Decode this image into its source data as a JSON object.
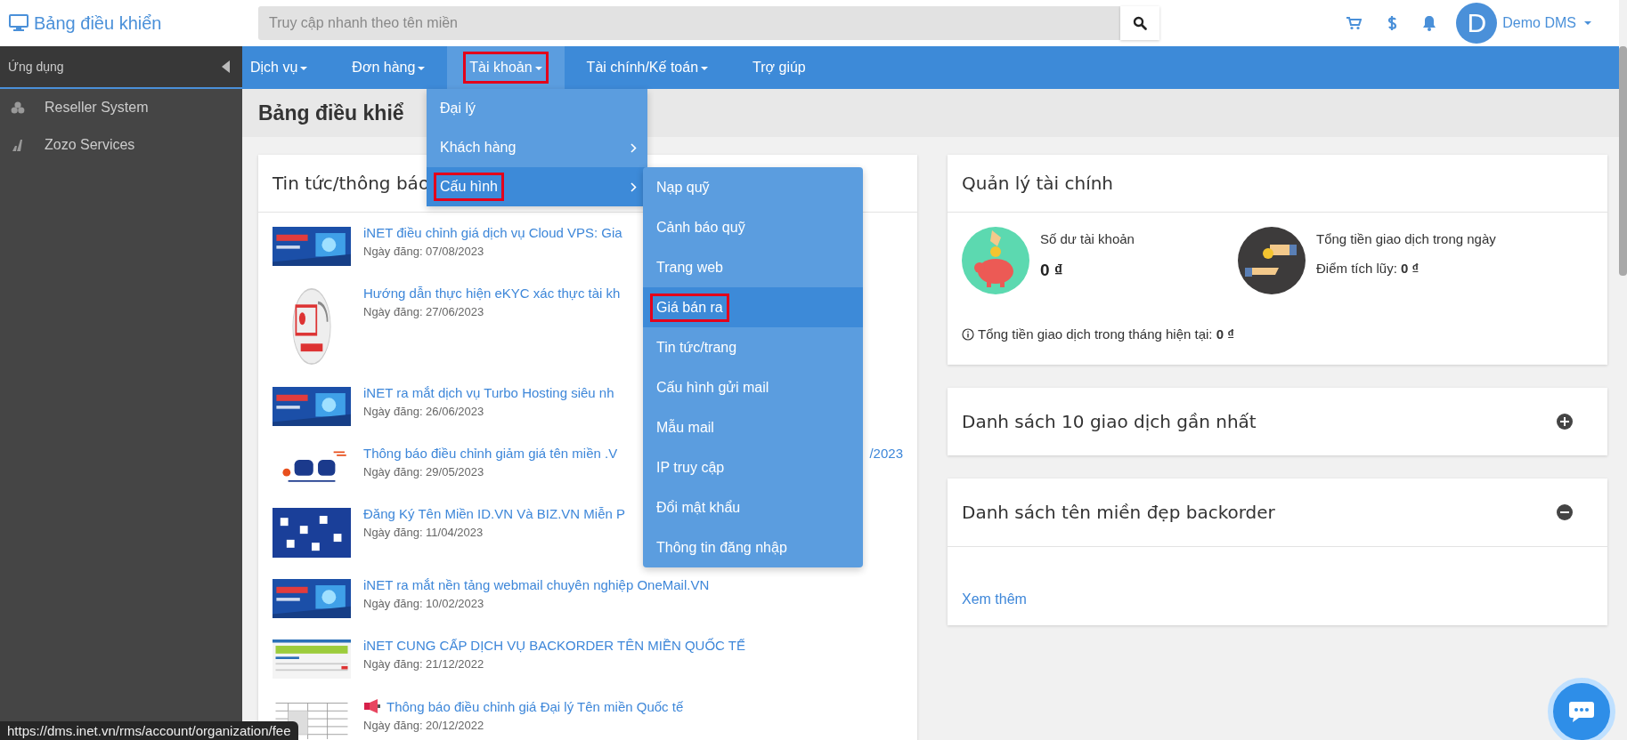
{
  "header": {
    "brand": "Bảng điều khiển",
    "search": {
      "placeholder": "Truy cập nhanh theo tên miền"
    },
    "user": {
      "initial": "D",
      "name": "Demo DMS"
    }
  },
  "sidebar": {
    "title": "Ứng dụng",
    "items": [
      {
        "label": "Reseller System"
      },
      {
        "label": "Zozo Services"
      }
    ]
  },
  "nav": [
    {
      "label": "Dịch vụ",
      "caret": true,
      "selected": false,
      "marked": false
    },
    {
      "label": "Đơn hàng",
      "caret": true,
      "selected": false,
      "marked": false
    },
    {
      "label": "Tài khoản",
      "caret": true,
      "selected": true,
      "marked": true
    },
    {
      "label": "Tài chính/Kế toán",
      "caret": true,
      "selected": false,
      "marked": false
    },
    {
      "label": "Trợ giúp",
      "caret": false,
      "selected": false,
      "marked": false
    }
  ],
  "menu": [
    {
      "label": "Đại lý",
      "submenu": false,
      "selected": false,
      "marked": false
    },
    {
      "label": "Khách hàng",
      "submenu": true,
      "selected": false,
      "marked": false
    },
    {
      "label": "Cấu hình",
      "submenu": true,
      "selected": true,
      "marked": true
    }
  ],
  "submenu": [
    {
      "label": "Nạp quỹ",
      "selected": false,
      "marked": false
    },
    {
      "label": "Cảnh báo quỹ",
      "selected": false,
      "marked": false
    },
    {
      "label": "Trang web",
      "selected": false,
      "marked": false
    },
    {
      "label": "Giá bán ra",
      "selected": true,
      "marked": true
    },
    {
      "label": "Tin tức/trang",
      "selected": false,
      "marked": false
    },
    {
      "label": "Cấu hình gửi mail",
      "selected": false,
      "marked": false
    },
    {
      "label": "Mẫu mail",
      "selected": false,
      "marked": false
    },
    {
      "label": "IP truy cập",
      "selected": false,
      "marked": false
    },
    {
      "label": "Đổi mật khẩu",
      "selected": false,
      "marked": false
    },
    {
      "label": "Thông tin đăng nhập",
      "selected": false,
      "marked": false
    }
  ],
  "page_title": "Bảng điều khiể",
  "news": {
    "title": "Tin tức/thông báo",
    "items": [
      {
        "title": "iNET điều chỉnh giá dịch vụ Cloud VPS: Gia",
        "date": "Ngày đăng: 07/08/2023"
      },
      {
        "title": "Hướng dẫn thực hiện eKYC xác thực tài kh",
        "date": "Ngày đăng: 27/06/2023"
      },
      {
        "title": "iNET ra mắt dịch vụ Turbo Hosting siêu nh",
        "date": "Ngày đăng: 26/06/2023"
      },
      {
        "title": "Thông báo điều chỉnh giảm giá tên miền .V",
        "title_tail": "/2023",
        "date": "Ngày đăng: 29/05/2023"
      },
      {
        "title": "Đăng Ký Tên Miền ID.VN Và BIZ.VN Miễn P",
        "date": "Ngày đăng: 11/04/2023"
      },
      {
        "title": "iNET ra mắt nền tảng webmail chuyên nghiệp OneMail.VN",
        "date": "Ngày đăng: 10/02/2023"
      },
      {
        "title": "iNET CUNG CẤP DỊCH VỤ BACKORDER TÊN MIỀN QUỐC TẾ",
        "date": "Ngày đăng: 21/12/2022"
      },
      {
        "title": "Thông báo điều chỉnh giá Đại lý Tên miền Quốc tế",
        "date": "Ngày đăng: 20/12/2022"
      }
    ]
  },
  "finance": {
    "title": "Quản lý tài chính",
    "balance": {
      "label": "Số dư tài khoản",
      "value": "0 ₫"
    },
    "daily": {
      "label": "Tổng tiền giao dịch trong ngày",
      "points": "Điểm tích lũy: **0 ₫**"
    },
    "monthly": "Tổng tiền giao dịch trong tháng hiện tại: **0 ₫**"
  },
  "panels": [
    {
      "title": "Danh sách 10 giao dịch gần nhất",
      "expanded": false
    },
    {
      "title": "Danh sách tên miền đẹp backorder",
      "expanded": true,
      "link": "Xem thêm"
    }
  ],
  "status_url": "https://dms.inet.vn/rms/account/organization/fee"
}
